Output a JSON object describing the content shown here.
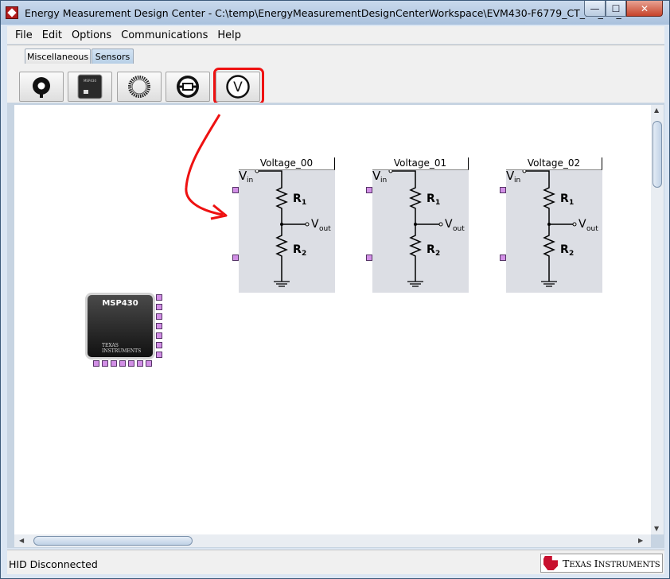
{
  "window": {
    "title": "Energy Measurement Design Center - C:\\temp\\EnergyMeasurementDesignCenterWorkspace\\EVM430-F6779_CT_3V_3C_60Hz",
    "controls": {
      "minimize": "—",
      "maximize": "☐",
      "close": "✕"
    }
  },
  "menu": [
    {
      "label": "File"
    },
    {
      "label": "Edit"
    },
    {
      "label": "Options"
    },
    {
      "label": "Communications"
    },
    {
      "label": "Help"
    }
  ],
  "tabs": [
    {
      "label": "Miscellaneous",
      "active": false
    },
    {
      "label": "Sensors",
      "active": true
    }
  ],
  "toolbar": [
    {
      "icon": "current-transformer-icon"
    },
    {
      "icon": "msp430-chip-icon",
      "text": "MSP430"
    },
    {
      "icon": "rogowski-coil-icon"
    },
    {
      "icon": "shunt-resistor-icon"
    },
    {
      "icon": "voltage-sensor-icon",
      "text": "V",
      "highlighted": true
    }
  ],
  "voltage_blocks": [
    {
      "name": "Voltage_00"
    },
    {
      "name": "Voltage_01"
    },
    {
      "name": "Voltage_02"
    }
  ],
  "schematic": {
    "vin": "V",
    "vin_sub": "in",
    "vout": "V",
    "vout_sub": "out",
    "r1": "R",
    "r1_sub": "1",
    "r2": "R",
    "r2_sub": "2"
  },
  "mcu": {
    "label": "MSP430",
    "vendor_line1": "TEXAS",
    "vendor_line2": "INSTRUMENTS"
  },
  "status": {
    "text": "HID Disconnected"
  },
  "logo": {
    "text1": "T",
    "text2": "EXAS ",
    "text3": "I",
    "text4": "NSTRUMENTS"
  },
  "colors": {
    "highlight": "#ee1111",
    "port": "#d28fe6",
    "ti_red": "#c8102e"
  }
}
